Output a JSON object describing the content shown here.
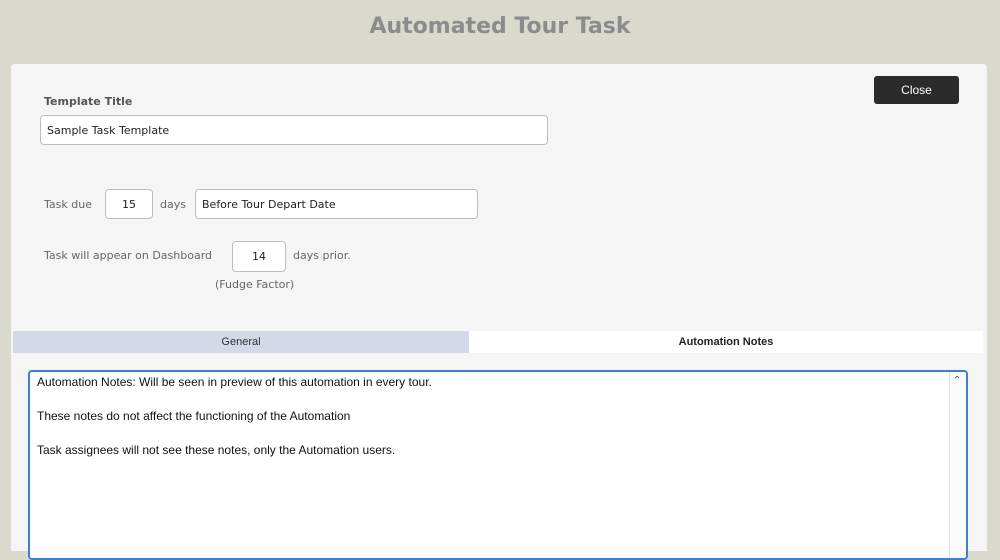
{
  "header": {
    "title": "Automated Tour Task"
  },
  "toolbar": {
    "close_label": "Close"
  },
  "template": {
    "title_label": "Template Title",
    "title_value": "Sample Task Template"
  },
  "schedule": {
    "task_due_label": "Task due",
    "due_days_value": "15",
    "days_label": "days",
    "timing_value": "Before Tour Depart Date",
    "dashboard_label": "Task will appear on Dashboard",
    "prior_days_value": "14",
    "days_prior_label": "days prior.",
    "fudge_label": "(Fudge Factor)"
  },
  "tabs": [
    {
      "label": "General",
      "active": false
    },
    {
      "label": "Automation Notes",
      "active": true
    }
  ],
  "notes": {
    "lines": [
      "Automation Notes: Will be seen in preview of this automation in every tour.",
      "These notes do not affect the functioning of the Automation",
      "Task assignees will not see these notes, only the Automation users."
    ]
  },
  "icons": {
    "scroll_up": "scroll-up-icon"
  },
  "colors": {
    "background": "#d9dacd",
    "panel": "#f5f5f5",
    "close_button": "#2b2b2b",
    "tab_inactive": "#d5d8e8",
    "focus_border": "#3c7fd1"
  }
}
